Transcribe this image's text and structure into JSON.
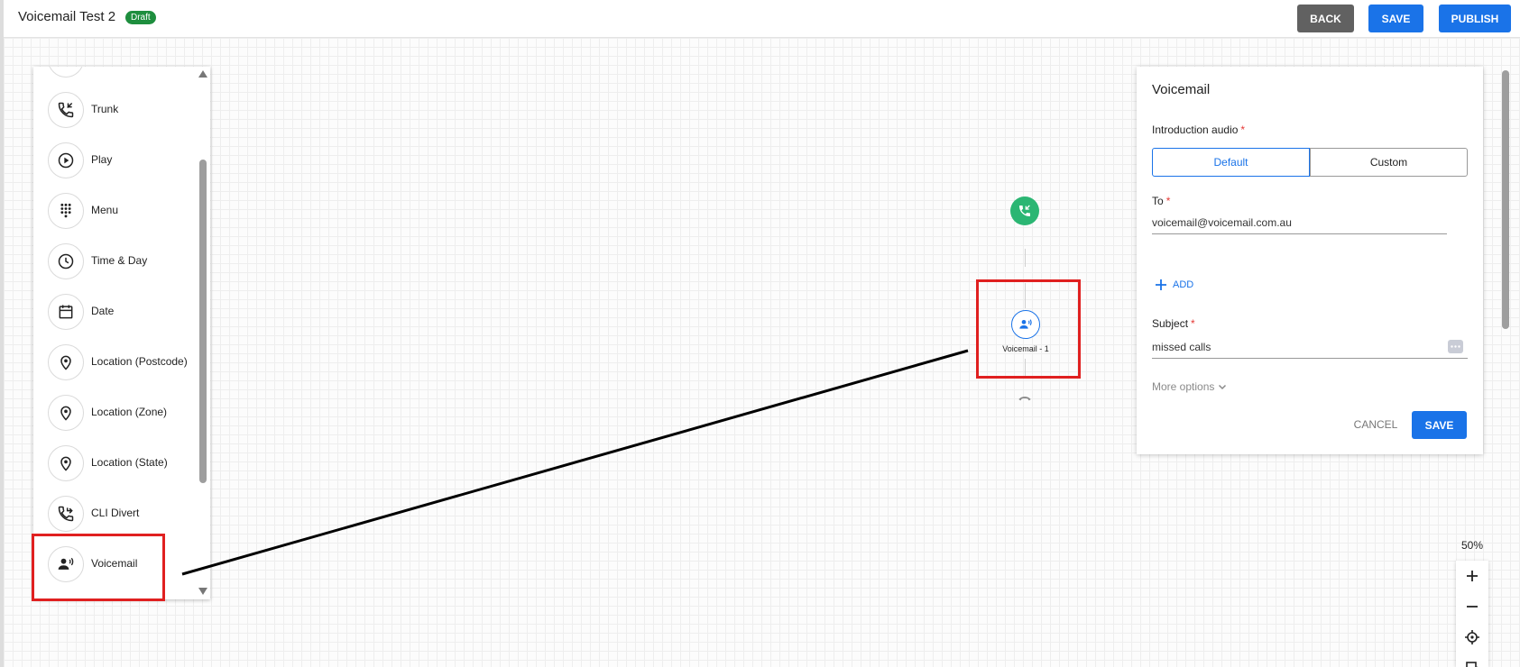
{
  "header": {
    "title": "Voicemail Test 2",
    "badge": "Draft",
    "back_label": "BACK",
    "save_label": "SAVE",
    "publish_label": "PUBLISH"
  },
  "palette": {
    "items": [
      {
        "label": "Trunk",
        "icon": "trunk-icon"
      },
      {
        "label": "Play",
        "icon": "play-icon"
      },
      {
        "label": "Menu",
        "icon": "dialpad-icon"
      },
      {
        "label": "Time & Day",
        "icon": "clock-icon"
      },
      {
        "label": "Date",
        "icon": "calendar-icon"
      },
      {
        "label": "Location (Postcode)",
        "icon": "location-pin-icon"
      },
      {
        "label": "Location (Zone)",
        "icon": "location-pin-icon"
      },
      {
        "label": "Location (State)",
        "icon": "location-pin-icon"
      },
      {
        "label": "CLI Divert",
        "icon": "call-forward-icon"
      },
      {
        "label": "Voicemail",
        "icon": "voicemail-person-icon"
      }
    ]
  },
  "flow": {
    "node_label": "Voicemail - 1"
  },
  "panel": {
    "title": "Voicemail",
    "intro_label": "Introduction audio",
    "required_mark": "*",
    "seg_default": "Default",
    "seg_custom": "Custom",
    "to_label": "To",
    "to_value": "voicemail@voicemail.com.au",
    "add_label": "ADD",
    "subject_label": "Subject",
    "subject_value": "missed calls",
    "more_options": "More options",
    "cancel_label": "CANCEL",
    "save_label": "SAVE"
  },
  "zoom": {
    "level": "50%"
  },
  "colors": {
    "primary": "#1a73e8",
    "start_node": "#2bb673",
    "highlight": "#e02020",
    "draft_badge": "#1e8e3e"
  }
}
